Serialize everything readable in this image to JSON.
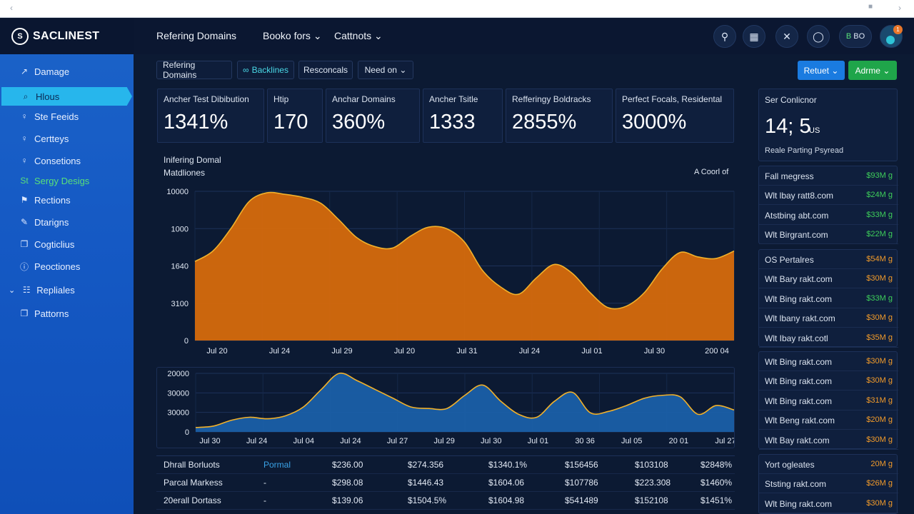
{
  "colors": {
    "accent_orange": "#d66a0c",
    "accent_blue": "#1a5fa8",
    "green": "#3ecf5a",
    "orange_text": "#f29b2a",
    "cyan": "#27b6ec"
  },
  "brand": {
    "name": "SACLINEST"
  },
  "sidebar": {
    "items": [
      {
        "label": "Damage",
        "icon": "chart-icon"
      },
      {
        "label": "Hlous",
        "icon": "search-icon"
      },
      {
        "label": "Ste Feeids",
        "icon": "person-icon"
      },
      {
        "label": "Certteys",
        "icon": "person-icon"
      },
      {
        "label": "Consetions",
        "icon": "person-icon"
      },
      {
        "label": "Sergy Desigs",
        "prefix": "St",
        "icon": "none"
      },
      {
        "label": "Rections",
        "icon": "flag-icon"
      },
      {
        "label": "Dtarigns",
        "icon": "edit-icon"
      },
      {
        "label": "Cogticlius",
        "icon": "document-icon"
      },
      {
        "label": "Peoctiones",
        "icon": "info-icon"
      },
      {
        "label": "Repliales",
        "icon": "clipboard-icon"
      },
      {
        "label": "Pattorns",
        "icon": "document-icon"
      }
    ]
  },
  "topbar": {
    "nav": [
      "Refering Domains",
      "Booko fors",
      "Cattnots"
    ],
    "icons": [
      "search-icon",
      "grid-icon",
      "tools-icon",
      "globe-icon",
      "badge-icon"
    ],
    "badge_label": "B",
    "badge_text": "BO",
    "avatar_count": "1"
  },
  "filters": {
    "chips": [
      "Refering Domains",
      "Backlines",
      "Resconcals",
      "Need on"
    ],
    "chip_icon": "link-icon",
    "reset_label": "Retuet",
    "action_label": "Adrme"
  },
  "metrics": [
    {
      "label": "Ancher Test Dibibution",
      "value": "1341%"
    },
    {
      "label": "Htip",
      "value": "170"
    },
    {
      "label": "Anchar Domains",
      "value": "360%"
    },
    {
      "label": "Ancher Tsitle",
      "value": "1333"
    },
    {
      "label": "Refferingy Boldracks",
      "value": "2855%"
    },
    {
      "label": "Perfect Focals, Residental",
      "value": "3000%"
    }
  ],
  "chart_main": {
    "title_line1": "Inifering Domal",
    "title_line2": "Matdliones",
    "legend_note": "A Coorl of"
  },
  "chart_data": [
    {
      "type": "area",
      "title": "Inifering Domal Matdliones",
      "y_tick_labels": [
        "10000",
        "1000",
        "1640",
        "3100",
        "0"
      ],
      "x_tick_labels": [
        "Jul 20",
        "Jul 24",
        "Jul 29",
        "Jul 20",
        "Jul 31",
        "Jul 24",
        "Jul 01",
        "Jul 30",
        "200 04"
      ],
      "ylim": [
        0,
        10000
      ],
      "x": [
        0,
        1,
        2,
        3,
        4,
        5,
        6,
        7,
        8,
        9,
        10,
        11,
        12,
        13,
        14,
        15,
        16,
        17,
        18,
        19,
        20,
        21,
        22,
        23,
        24,
        25,
        26,
        27,
        28,
        29,
        30
      ],
      "values": [
        5300,
        6000,
        7500,
        9300,
        9900,
        9800,
        9600,
        9200,
        8100,
        6900,
        6300,
        6200,
        7000,
        7600,
        7500,
        6600,
        4700,
        3600,
        3100,
        4200,
        5100,
        4500,
        3200,
        2200,
        2300,
        3200,
        4800,
        5900,
        5600,
        5500,
        6000
      ],
      "color": "#d66a0c",
      "grid": true
    },
    {
      "type": "area",
      "y_tick_labels": [
        "20000",
        "30000",
        "30000",
        "0"
      ],
      "x_tick_labels": [
        "Jul 30",
        "Jul 24",
        "Jul 04",
        "Jul 24",
        "Jul 27",
        "Jul 29",
        "Jul 30",
        "Jul 01",
        "30 36",
        "Jul 05",
        "20 01",
        "Jul 27"
      ],
      "ylim": [
        0,
        40000
      ],
      "x": [
        0,
        1,
        2,
        3,
        4,
        5,
        6,
        7,
        8,
        9,
        10,
        11,
        12,
        13,
        14,
        15,
        16,
        17,
        18,
        19,
        20,
        21,
        22,
        23,
        24,
        25,
        26,
        27,
        28,
        29,
        30
      ],
      "values": [
        3000,
        4000,
        8000,
        10000,
        9000,
        11000,
        17000,
        29000,
        40000,
        35000,
        29000,
        23000,
        17000,
        16000,
        16000,
        25000,
        32000,
        21000,
        12000,
        10000,
        21000,
        27000,
        13000,
        14000,
        18000,
        23000,
        25000,
        24000,
        12000,
        18000,
        15000
      ],
      "color": "#1a5fa8",
      "grid": true
    }
  ],
  "table": {
    "rows": [
      {
        "name": "Dhrall Borluots",
        "col2": "Pormal",
        "cells": [
          "$236.00",
          "$274.356",
          "$1340.1%",
          "$156456",
          "$103108",
          "$2848%"
        ]
      },
      {
        "name": "Parcal Markess",
        "col2": "-",
        "cells": [
          "$298.08",
          "$1446.43",
          "$1604.06",
          "$107786",
          "$223.308",
          "$1460%"
        ]
      },
      {
        "name": "20erall Dortass",
        "col2": "-",
        "cells": [
          "$139.06",
          "$1504.5%",
          "$1604.98",
          "$541489",
          "$152108",
          "$1451%"
        ]
      }
    ]
  },
  "right_panel": {
    "stat": {
      "title": "Ser Conlicnor",
      "value": "14; 5",
      "unit": "US",
      "caption": "Reale Parting Psyread"
    },
    "group1": [
      {
        "name": "Fall megress",
        "value": "$93M g",
        "status": "green"
      },
      {
        "name": "Wlt lbay ratt8.com",
        "value": "$24M g",
        "status": "green"
      },
      {
        "name": "Atstbing abt.com",
        "value": "$33M g",
        "status": "green"
      },
      {
        "name": "Wlt Birgrant.com",
        "value": "$22M g",
        "status": "green"
      }
    ],
    "group2": [
      {
        "name": "OS Pertalres",
        "value": "$54M g",
        "status": "orange"
      },
      {
        "name": "Wlt Bary rakt.com",
        "value": "$30M g",
        "status": "orange"
      },
      {
        "name": "Wlt Bing rakt.com",
        "value": "$33M g",
        "status": "green"
      },
      {
        "name": "Wlt lbany rakt.com",
        "value": "$30M g",
        "status": "orange"
      },
      {
        "name": "Wlt Ibay rakt.cotl",
        "value": "$35M g",
        "status": "orange"
      }
    ],
    "group3": [
      {
        "name": "Wlt Bing rakt.com",
        "value": "$30M g",
        "status": "orange"
      },
      {
        "name": "Wlt Bing rakt.com",
        "value": "$30M g",
        "status": "orange"
      },
      {
        "name": "Wlt Bing rakt.com",
        "value": "$31M g",
        "status": "orange"
      },
      {
        "name": "Wlt Beng rakt.com",
        "value": "$20M g",
        "status": "orange"
      },
      {
        "name": "Wlt Bay rakt.com",
        "value": "$30M g",
        "status": "orange"
      }
    ],
    "group4": [
      {
        "name": "Yort ogleates",
        "value": "20M g",
        "status": "orange"
      },
      {
        "name": "Ststing rakt.com",
        "value": "$26M g",
        "status": "orange"
      },
      {
        "name": "Wlt Bing rakt.com",
        "value": "$30M g",
        "status": "orange"
      }
    ]
  }
}
